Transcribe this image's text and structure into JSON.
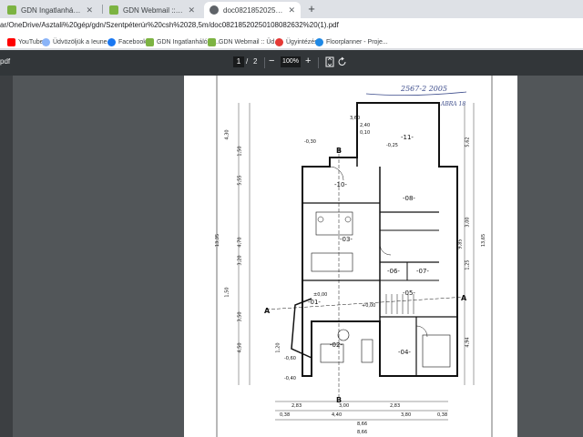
{
  "tabs": [
    {
      "title": "GDN Ingatlanhálózat Admin fe",
      "favicon": "gdn-favicon",
      "active": false
    },
    {
      "title": "GDN Webmail :: tervrajz",
      "favicon": "gdn-favicon",
      "active": false
    },
    {
      "title": "doc08218520250108082632(1).pdf",
      "favicon": "globe-icon",
      "active": true
    }
  ],
  "url": "ar/OneDrive/Asztali%20gép/gdn/Szentpéterúr%20csh%2028,5m/doc08218520250108082632%20(1).pdf",
  "bookmarks": [
    {
      "label": "YouTube",
      "icon": "youtube-icon",
      "color": "#ff0000"
    },
    {
      "label": "Üdvözöljük a Ieune...",
      "icon": "globe-icon",
      "color": "#8ab4f8"
    },
    {
      "label": "Facebook",
      "icon": "facebook-icon",
      "color": "#1877f2"
    },
    {
      "label": "GDN Ingatlanhálóza...",
      "icon": "gdn-icon",
      "color": "#7cb342"
    },
    {
      "label": "GDN Webmail :: Üd...",
      "icon": "gdn-icon",
      "color": "#7cb342"
    },
    {
      "label": "Ügyintézés",
      "icon": "gov-icon",
      "color": "#e53935"
    },
    {
      "label": "Floorplanner - Proje...",
      "icon": "floorplanner-icon",
      "color": "#1e88e5"
    }
  ],
  "pdf": {
    "title_fragment": "pdf",
    "page_current": "1",
    "page_sep": "/",
    "page_total": "2",
    "zoom": "100%",
    "zoom_out": "−",
    "zoom_in": "+"
  },
  "plan": {
    "header_note": "2567-2 2005",
    "sheet_note": "ABRA 18",
    "rooms": [
      "-11-",
      "-10-",
      "-08-",
      "-03-",
      "-06-",
      "-07-",
      "-05-",
      "-02-",
      "-04-",
      "-01-"
    ],
    "section_marks": [
      "B",
      "B",
      "A",
      "A"
    ],
    "levels": [
      "-0,30",
      "-0,25",
      "+0,00",
      "±0,00",
      "-0,60",
      "-0,40"
    ],
    "dims_bottom": [
      "2,83",
      "3,00",
      "2,83",
      "0,38",
      "4,40",
      "3,80",
      "0,38",
      "8,66",
      "8,66"
    ],
    "dims_left": [
      "4,30",
      "1,50",
      "5,55",
      "4,70",
      "13,35",
      "3,20",
      "1,50",
      "3,50",
      "4,50",
      "1,20"
    ],
    "dims_right": [
      "5,62",
      "3,00",
      "13,65",
      "9,85",
      "1,25",
      "4,94"
    ],
    "dims_top": [
      "3,60",
      "2,40",
      "0,10"
    ]
  }
}
